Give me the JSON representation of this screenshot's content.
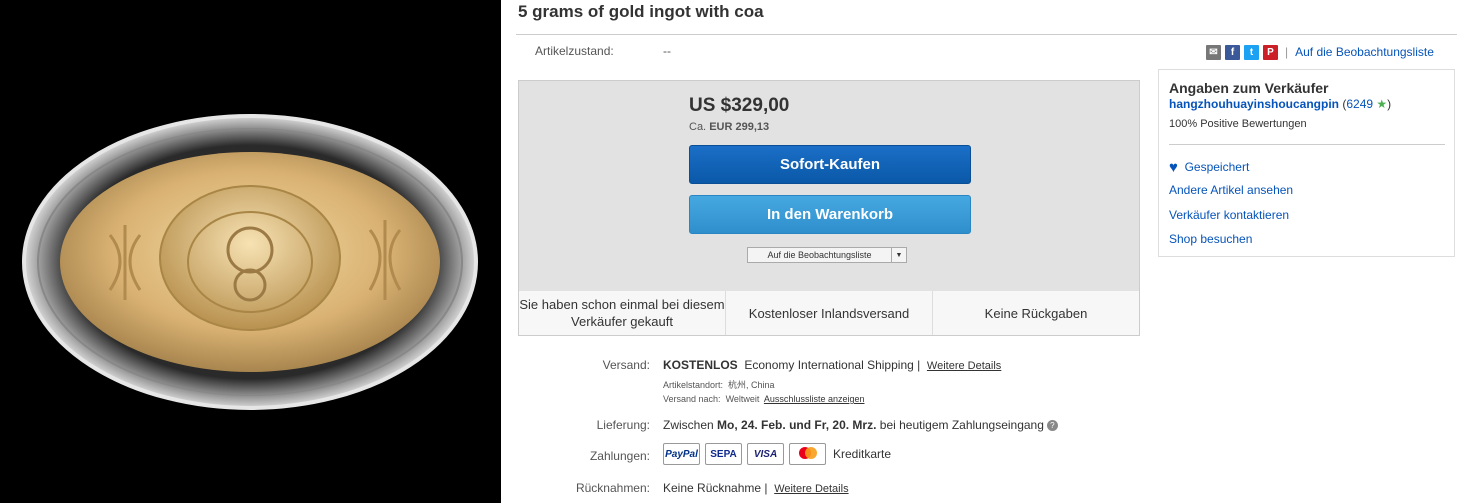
{
  "product": {
    "title": "5 grams of gold ingot with coa"
  },
  "condition": {
    "label": "Artikelzustand:",
    "value": "--"
  },
  "share": {
    "icons": [
      "mail-icon",
      "facebook-icon",
      "twitter-icon",
      "pinterest-icon"
    ],
    "watchlist_link": "Auf die Beobachtungsliste"
  },
  "buybox": {
    "price": "US $329,00",
    "approx_prefix": "Ca.",
    "approx_value": "EUR 299,13",
    "buy_now": "Sofort-Kaufen",
    "add_to_cart": "In den Warenkorb",
    "watch_dropdown": "Auf die Beobachtungsliste",
    "features": [
      "Sie haben schon einmal bei diesem Verkäufer gekauft",
      "Kostenloser Inlandsversand",
      "Keine Rückgaben"
    ],
    "colors": {
      "buy": "#0a58a8",
      "cart": "#2f8fcd",
      "box": "#e2e2e2"
    }
  },
  "shipping": {
    "label": "Versand:",
    "free": "KOSTENLOS",
    "method": "Economy International Shipping |",
    "details_link": "Weitere Details",
    "location_label": "Artikelstandort:",
    "location": "杭州, China",
    "ships_to_label": "Versand nach:",
    "ships_to": "Weltweit",
    "exclusion_link": "Ausschlussliste anzeigen"
  },
  "delivery": {
    "label": "Lieferung:",
    "prefix": "Zwischen",
    "from": "Mo, 24. Feb.",
    "and": "und",
    "to": "Fr, 20. Mrz.",
    "suffix": "bei heutigem Zahlungseingang"
  },
  "payment": {
    "label": "Zahlungen:",
    "logos": [
      "PayPal",
      "SEPA",
      "VISA",
      "mastercard"
    ],
    "card_label": "Kreditkarte"
  },
  "returns": {
    "label": "Rücknahmen:",
    "value": "Keine Rücknahme |",
    "details_link": "Weitere Details"
  },
  "seller": {
    "heading": "Angaben zum Verkäufer",
    "name": "hangzhouhuayinshoucangpin",
    "feedback_count": "6249",
    "positive": "100% Positive Bewertungen",
    "saved": "Gespeichert",
    "links": [
      "Andere Artikel ansehen",
      "Verkäufer kontaktieren",
      "Shop besuchen"
    ]
  }
}
